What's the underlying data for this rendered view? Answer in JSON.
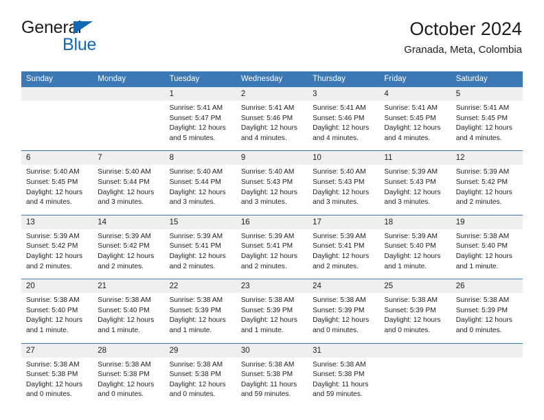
{
  "logo": {
    "word_top": "General",
    "word_bottom": "Blue",
    "accent_color": "#1168b4"
  },
  "header": {
    "title": "October 2024",
    "subtitle": "Granada, Meta, Colombia"
  },
  "theme": {
    "header_blue": "#3c78b4",
    "daynum_gray": "#efefef",
    "text": "#1d1d1d"
  },
  "labels": {
    "sunrise_prefix": "Sunrise:",
    "sunset_prefix": "Sunset:",
    "daylight_prefix": "Daylight:"
  },
  "weekdays": [
    "Sunday",
    "Monday",
    "Tuesday",
    "Wednesday",
    "Thursday",
    "Friday",
    "Saturday"
  ],
  "weeks": [
    [
      {
        "day": "",
        "sunrise": "",
        "sunset": "",
        "daylight1": "",
        "daylight2": ""
      },
      {
        "day": "",
        "sunrise": "",
        "sunset": "",
        "daylight1": "",
        "daylight2": ""
      },
      {
        "day": "1",
        "sunrise": "Sunrise: 5:41 AM",
        "sunset": "Sunset: 5:47 PM",
        "daylight1": "Daylight: 12 hours",
        "daylight2": "and 5 minutes."
      },
      {
        "day": "2",
        "sunrise": "Sunrise: 5:41 AM",
        "sunset": "Sunset: 5:46 PM",
        "daylight1": "Daylight: 12 hours",
        "daylight2": "and 4 minutes."
      },
      {
        "day": "3",
        "sunrise": "Sunrise: 5:41 AM",
        "sunset": "Sunset: 5:46 PM",
        "daylight1": "Daylight: 12 hours",
        "daylight2": "and 4 minutes."
      },
      {
        "day": "4",
        "sunrise": "Sunrise: 5:41 AM",
        "sunset": "Sunset: 5:45 PM",
        "daylight1": "Daylight: 12 hours",
        "daylight2": "and 4 minutes."
      },
      {
        "day": "5",
        "sunrise": "Sunrise: 5:41 AM",
        "sunset": "Sunset: 5:45 PM",
        "daylight1": "Daylight: 12 hours",
        "daylight2": "and 4 minutes."
      }
    ],
    [
      {
        "day": "6",
        "sunrise": "Sunrise: 5:40 AM",
        "sunset": "Sunset: 5:45 PM",
        "daylight1": "Daylight: 12 hours",
        "daylight2": "and 4 minutes."
      },
      {
        "day": "7",
        "sunrise": "Sunrise: 5:40 AM",
        "sunset": "Sunset: 5:44 PM",
        "daylight1": "Daylight: 12 hours",
        "daylight2": "and 3 minutes."
      },
      {
        "day": "8",
        "sunrise": "Sunrise: 5:40 AM",
        "sunset": "Sunset: 5:44 PM",
        "daylight1": "Daylight: 12 hours",
        "daylight2": "and 3 minutes."
      },
      {
        "day": "9",
        "sunrise": "Sunrise: 5:40 AM",
        "sunset": "Sunset: 5:43 PM",
        "daylight1": "Daylight: 12 hours",
        "daylight2": "and 3 minutes."
      },
      {
        "day": "10",
        "sunrise": "Sunrise: 5:40 AM",
        "sunset": "Sunset: 5:43 PM",
        "daylight1": "Daylight: 12 hours",
        "daylight2": "and 3 minutes."
      },
      {
        "day": "11",
        "sunrise": "Sunrise: 5:39 AM",
        "sunset": "Sunset: 5:43 PM",
        "daylight1": "Daylight: 12 hours",
        "daylight2": "and 3 minutes."
      },
      {
        "day": "12",
        "sunrise": "Sunrise: 5:39 AM",
        "sunset": "Sunset: 5:42 PM",
        "daylight1": "Daylight: 12 hours",
        "daylight2": "and 2 minutes."
      }
    ],
    [
      {
        "day": "13",
        "sunrise": "Sunrise: 5:39 AM",
        "sunset": "Sunset: 5:42 PM",
        "daylight1": "Daylight: 12 hours",
        "daylight2": "and 2 minutes."
      },
      {
        "day": "14",
        "sunrise": "Sunrise: 5:39 AM",
        "sunset": "Sunset: 5:42 PM",
        "daylight1": "Daylight: 12 hours",
        "daylight2": "and 2 minutes."
      },
      {
        "day": "15",
        "sunrise": "Sunrise: 5:39 AM",
        "sunset": "Sunset: 5:41 PM",
        "daylight1": "Daylight: 12 hours",
        "daylight2": "and 2 minutes."
      },
      {
        "day": "16",
        "sunrise": "Sunrise: 5:39 AM",
        "sunset": "Sunset: 5:41 PM",
        "daylight1": "Daylight: 12 hours",
        "daylight2": "and 2 minutes."
      },
      {
        "day": "17",
        "sunrise": "Sunrise: 5:39 AM",
        "sunset": "Sunset: 5:41 PM",
        "daylight1": "Daylight: 12 hours",
        "daylight2": "and 2 minutes."
      },
      {
        "day": "18",
        "sunrise": "Sunrise: 5:39 AM",
        "sunset": "Sunset: 5:40 PM",
        "daylight1": "Daylight: 12 hours",
        "daylight2": "and 1 minute."
      },
      {
        "day": "19",
        "sunrise": "Sunrise: 5:38 AM",
        "sunset": "Sunset: 5:40 PM",
        "daylight1": "Daylight: 12 hours",
        "daylight2": "and 1 minute."
      }
    ],
    [
      {
        "day": "20",
        "sunrise": "Sunrise: 5:38 AM",
        "sunset": "Sunset: 5:40 PM",
        "daylight1": "Daylight: 12 hours",
        "daylight2": "and 1 minute."
      },
      {
        "day": "21",
        "sunrise": "Sunrise: 5:38 AM",
        "sunset": "Sunset: 5:40 PM",
        "daylight1": "Daylight: 12 hours",
        "daylight2": "and 1 minute."
      },
      {
        "day": "22",
        "sunrise": "Sunrise: 5:38 AM",
        "sunset": "Sunset: 5:39 PM",
        "daylight1": "Daylight: 12 hours",
        "daylight2": "and 1 minute."
      },
      {
        "day": "23",
        "sunrise": "Sunrise: 5:38 AM",
        "sunset": "Sunset: 5:39 PM",
        "daylight1": "Daylight: 12 hours",
        "daylight2": "and 1 minute."
      },
      {
        "day": "24",
        "sunrise": "Sunrise: 5:38 AM",
        "sunset": "Sunset: 5:39 PM",
        "daylight1": "Daylight: 12 hours",
        "daylight2": "and 0 minutes."
      },
      {
        "day": "25",
        "sunrise": "Sunrise: 5:38 AM",
        "sunset": "Sunset: 5:39 PM",
        "daylight1": "Daylight: 12 hours",
        "daylight2": "and 0 minutes."
      },
      {
        "day": "26",
        "sunrise": "Sunrise: 5:38 AM",
        "sunset": "Sunset: 5:39 PM",
        "daylight1": "Daylight: 12 hours",
        "daylight2": "and 0 minutes."
      }
    ],
    [
      {
        "day": "27",
        "sunrise": "Sunrise: 5:38 AM",
        "sunset": "Sunset: 5:38 PM",
        "daylight1": "Daylight: 12 hours",
        "daylight2": "and 0 minutes."
      },
      {
        "day": "28",
        "sunrise": "Sunrise: 5:38 AM",
        "sunset": "Sunset: 5:38 PM",
        "daylight1": "Daylight: 12 hours",
        "daylight2": "and 0 minutes."
      },
      {
        "day": "29",
        "sunrise": "Sunrise: 5:38 AM",
        "sunset": "Sunset: 5:38 PM",
        "daylight1": "Daylight: 12 hours",
        "daylight2": "and 0 minutes."
      },
      {
        "day": "30",
        "sunrise": "Sunrise: 5:38 AM",
        "sunset": "Sunset: 5:38 PM",
        "daylight1": "Daylight: 11 hours",
        "daylight2": "and 59 minutes."
      },
      {
        "day": "31",
        "sunrise": "Sunrise: 5:38 AM",
        "sunset": "Sunset: 5:38 PM",
        "daylight1": "Daylight: 11 hours",
        "daylight2": "and 59 minutes."
      },
      {
        "day": "",
        "sunrise": "",
        "sunset": "",
        "daylight1": "",
        "daylight2": ""
      },
      {
        "day": "",
        "sunrise": "",
        "sunset": "",
        "daylight1": "",
        "daylight2": ""
      }
    ]
  ]
}
